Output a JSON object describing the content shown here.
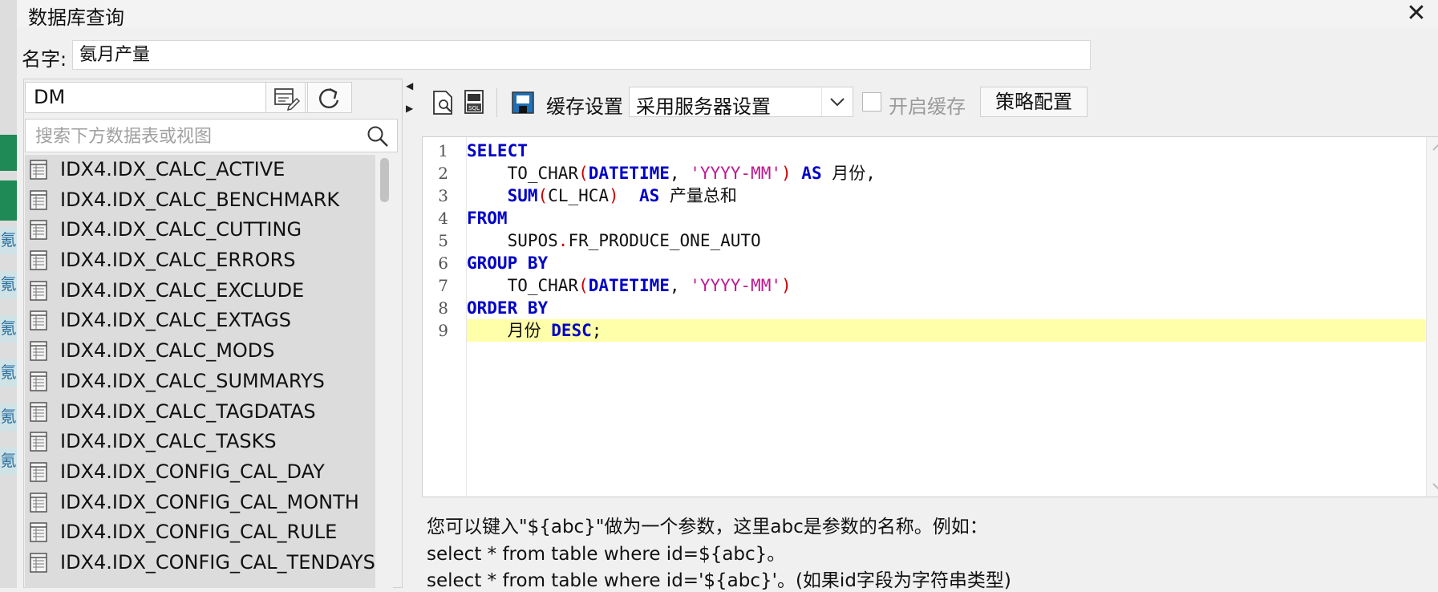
{
  "dialog": {
    "title": "数据库查询"
  },
  "name_field": {
    "label": "名字:",
    "value": "氨月产量"
  },
  "left": {
    "db_value": "DM",
    "search_placeholder": "搜索下方数据表或视图",
    "tables": [
      "IDX4.IDX_CALC_ACTIVE",
      "IDX4.IDX_CALC_BENCHMARK",
      "IDX4.IDX_CALC_CUTTING",
      "IDX4.IDX_CALC_ERRORS",
      "IDX4.IDX_CALC_EXCLUDE",
      "IDX4.IDX_CALC_EXTAGS",
      "IDX4.IDX_CALC_MODS",
      "IDX4.IDX_CALC_SUMMARYS",
      "IDX4.IDX_CALC_TAGDATAS",
      "IDX4.IDX_CALC_TASKS",
      "IDX4.IDX_CONFIG_CAL_DAY",
      "IDX4.IDX_CONFIG_CAL_MONTH",
      "IDX4.IDX_CONFIG_CAL_RULE",
      "IDX4.IDX_CONFIG_CAL_TENDAYS"
    ]
  },
  "toolbar": {
    "cache_label": "缓存设置",
    "cache_value": "采用服务器设置",
    "enable_cache_label": "开启缓存",
    "strategy_button": "策略配置"
  },
  "editor": {
    "line_numbers": [
      "1",
      "2",
      "3",
      "4",
      "5",
      "6",
      "7",
      "8",
      "9"
    ],
    "lines": [
      [
        {
          "t": "SELECT",
          "k": "kw"
        }
      ],
      [
        {
          "t": "    TO_CHAR"
        },
        {
          "t": "(",
          "k": "paren"
        },
        {
          "t": "DATETIME",
          "k": "kw"
        },
        {
          "t": ", "
        },
        {
          "t": "'YYYY-MM'",
          "k": "str"
        },
        {
          "t": ")",
          "k": "paren"
        },
        {
          "t": " "
        },
        {
          "t": "AS",
          "k": "kw"
        },
        {
          "t": " 月份,"
        }
      ],
      [
        {
          "t": "    "
        },
        {
          "t": "SUM",
          "k": "kw"
        },
        {
          "t": "(",
          "k": "paren"
        },
        {
          "t": "CL_HCA"
        },
        {
          "t": ")",
          "k": "paren"
        },
        {
          "t": "  "
        },
        {
          "t": "AS",
          "k": "kw"
        },
        {
          "t": " 产量总和"
        }
      ],
      [
        {
          "t": "FROM",
          "k": "kw"
        }
      ],
      [
        {
          "t": "    SUPOS"
        },
        {
          "t": ".",
          "k": "paren"
        },
        {
          "t": "FR_PRODUCE_ONE_AUTO"
        }
      ],
      [
        {
          "t": "GROUP BY",
          "k": "kw"
        }
      ],
      [
        {
          "t": "    TO_CHAR"
        },
        {
          "t": "(",
          "k": "paren"
        },
        {
          "t": "DATETIME",
          "k": "kw"
        },
        {
          "t": ", "
        },
        {
          "t": "'YYYY-MM'",
          "k": "str"
        },
        {
          "t": ")",
          "k": "paren"
        }
      ],
      [
        {
          "t": "ORDER BY",
          "k": "kw"
        }
      ],
      [
        {
          "t": "    月份 "
        },
        {
          "t": "DESC",
          "k": "kw"
        },
        {
          "t": ";"
        }
      ]
    ],
    "highlight_line": 9
  },
  "hint": {
    "line1": "您可以键入\"${abc}\"做为一个参数，这里abc是参数的名称。例如：",
    "line2": "select * from table where id=${abc}。",
    "line3": "select * from table where id='${abc}'。(如果id字段为字符串类型)"
  },
  "colors": {
    "keyword": "#0000c8",
    "string": "#c0178f",
    "paren": "#cc0000",
    "highlight": "#ffffaa"
  }
}
